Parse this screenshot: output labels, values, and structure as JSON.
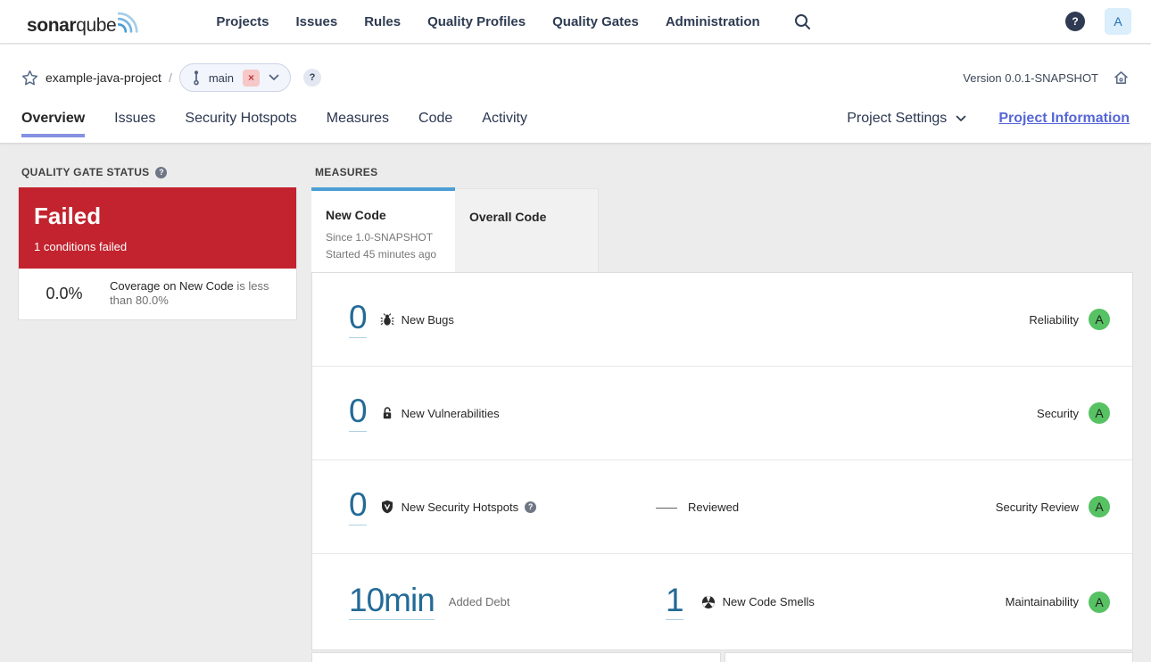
{
  "nav": {
    "logo_bold": "sonar",
    "logo_light": "qube",
    "items": [
      "Projects",
      "Issues",
      "Rules",
      "Quality Profiles",
      "Quality Gates",
      "Administration"
    ],
    "help": "?",
    "avatar": "A"
  },
  "header": {
    "project": "example-java-project",
    "separator": "/",
    "branch": {
      "name": "main",
      "badge": "×",
      "help": "?"
    },
    "version": "Version 0.0.1-SNAPSHOT",
    "tabs": [
      "Overview",
      "Issues",
      "Security Hotspots",
      "Measures",
      "Code",
      "Activity"
    ],
    "project_settings": "Project Settings",
    "project_information": "Project Information"
  },
  "quality_gate": {
    "title": "QUALITY GATE STATUS",
    "help": "?",
    "status": "Failed",
    "conditions_failed": "1 conditions failed",
    "condition": {
      "value": "0.0%",
      "metric": "Coverage on New Code",
      "rest": " is less than 80.0%"
    }
  },
  "measures": {
    "title": "MEASURES",
    "tabs": {
      "new_code": {
        "label": "New Code",
        "line1": "Since 1.0-SNAPSHOT",
        "line2": "Started 45 minutes ago"
      },
      "overall_code": {
        "label": "Overall Code"
      }
    },
    "rows": [
      {
        "value": "0",
        "label": "New Bugs",
        "rating_label": "Reliability",
        "rating": "A"
      },
      {
        "value": "0",
        "label": "New Vulnerabilities",
        "rating_label": "Security",
        "rating": "A"
      },
      {
        "value": "0",
        "label": "New Security Hotspots",
        "help": "?",
        "reviewed_value": "—",
        "reviewed_label": "Reviewed",
        "rating_label": "Security Review",
        "rating": "A"
      },
      {
        "value": "10min",
        "label": "Added Debt",
        "value2": "1",
        "label2": "New Code Smells",
        "rating_label": "Maintainability",
        "rating": "A"
      }
    ]
  },
  "colors": {
    "failed_red": "#c2232e",
    "rating_green": "#56c263",
    "metric_link_blue": "#236a97",
    "new_code_tab_blue": "#4b9fd5",
    "active_tab_underline": "#8591e0",
    "project_information_link": "#5667d6",
    "logo_wave_blue": "#4a9cd5"
  }
}
